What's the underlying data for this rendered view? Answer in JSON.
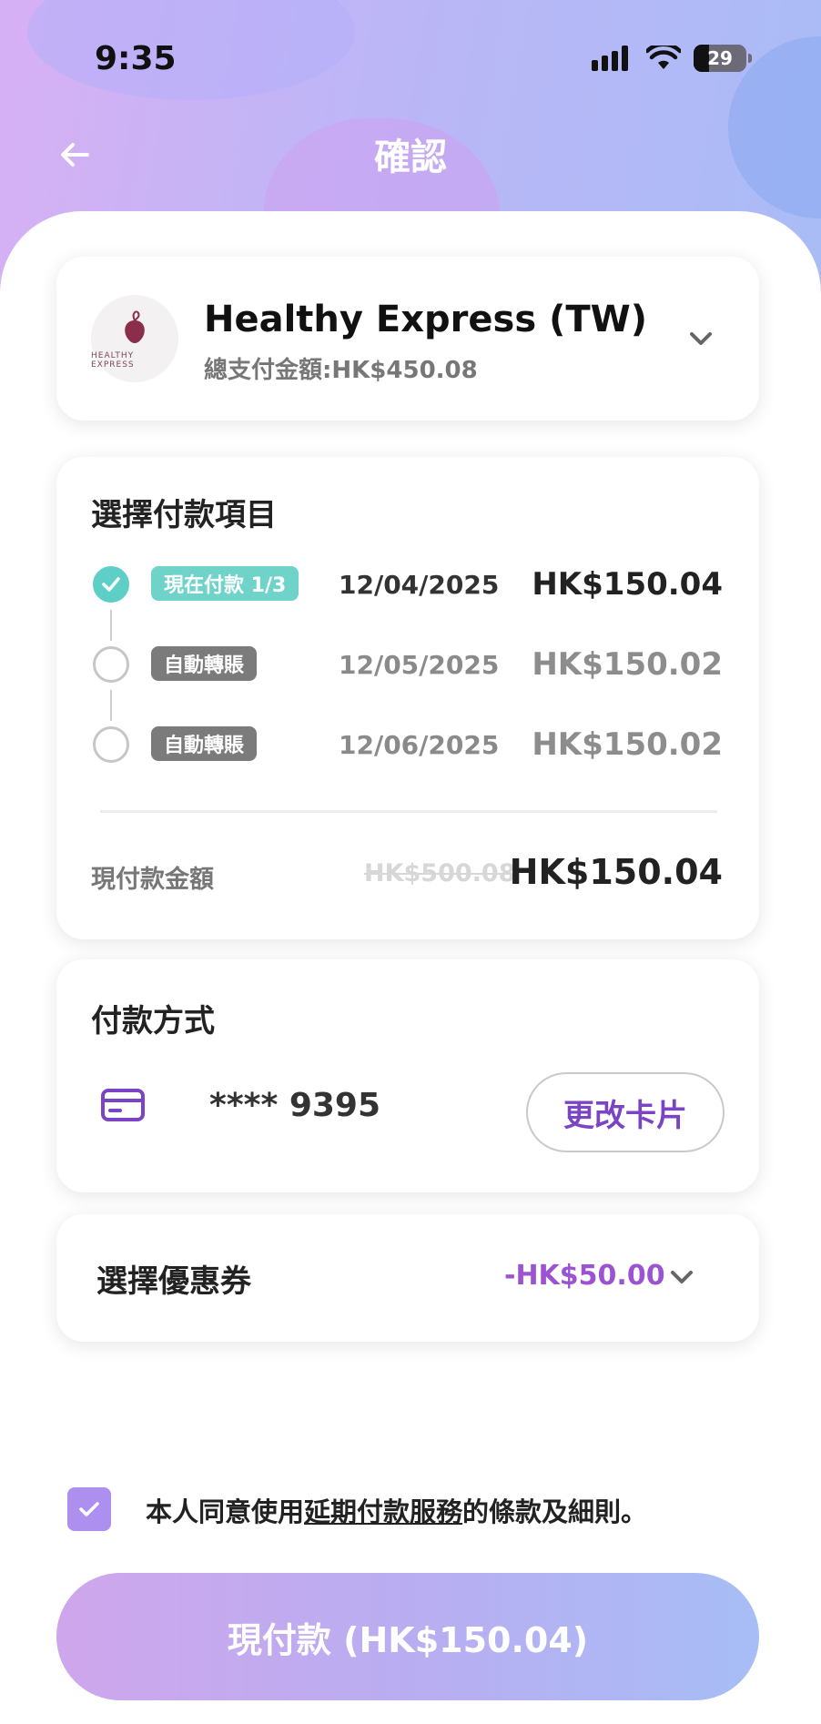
{
  "status_bar": {
    "time": "9:35",
    "battery": "29"
  },
  "header": {
    "title": "確認"
  },
  "merchant": {
    "name": "Healthy Express (TW)",
    "total": "總支付金額:HK$450.08",
    "logo_text": "HEALTHY EXPRESS"
  },
  "plan": {
    "title": "選擇付款項目",
    "items": [
      {
        "badge": "現在付款 1/3",
        "date": "12/04/2025",
        "amount": "HK$150.04"
      },
      {
        "badge": "自動轉賬",
        "date": "12/05/2025",
        "amount": "HK$150.02"
      },
      {
        "badge": "自動轉賬",
        "date": "12/06/2025",
        "amount": "HK$150.02"
      }
    ],
    "now_label": "現付款金額",
    "original_amount": "HK$500.08",
    "now_amount": "HK$150.04"
  },
  "payment_method": {
    "title": "付款方式",
    "card_number": "**** 9395",
    "change_label": "更改卡片"
  },
  "coupon": {
    "label": "選擇優惠券",
    "value": "-HK$50.00"
  },
  "agreement": {
    "prefix": "本人同意使用",
    "link": "延期付款服務",
    "suffix": "的條款及細則。"
  },
  "pay_button": {
    "label": "現付款 (HK$150.04)"
  },
  "colors": {
    "accent_purple": "#7a44c4",
    "teal": "#5ecfc6",
    "coupon_purple": "#9b52d3"
  }
}
